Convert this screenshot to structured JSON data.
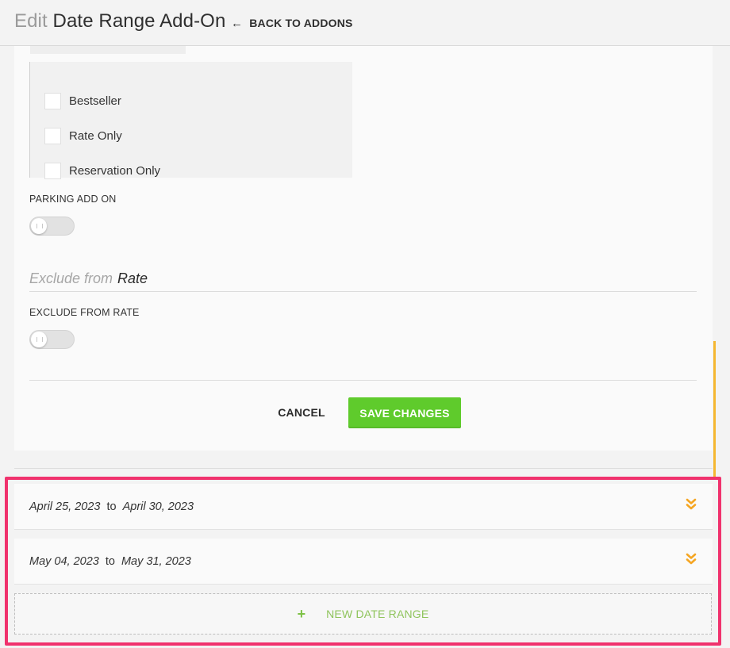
{
  "header": {
    "edit_word": "Edit",
    "title": "Date Range Add-On",
    "back_label": "BACK TO ADDONS"
  },
  "options": [
    {
      "label": "Bestseller",
      "checked": false
    },
    {
      "label": "Rate Only",
      "checked": false
    },
    {
      "label": "Reservation Only",
      "checked": false
    }
  ],
  "parking": {
    "label": "PARKING ADD ON",
    "enabled": false
  },
  "exclude_section": {
    "muted": "Exclude from",
    "strong": "Rate"
  },
  "exclude_rate": {
    "label": "EXCLUDE FROM RATE",
    "enabled": false
  },
  "actions": {
    "cancel": "CANCEL",
    "save": "SAVE CHANGES"
  },
  "date_ranges": [
    {
      "start": "April 25, 2023",
      "to": "to",
      "end": "April 30, 2023"
    },
    {
      "start": "May 04, 2023",
      "to": "to",
      "end": "May 31, 2023"
    }
  ],
  "new_range": {
    "icon": "+",
    "label": "NEW DATE RANGE"
  },
  "colors": {
    "accent_green": "#5fcb2c",
    "highlight": "#f0326d",
    "expand_orange": "#f5a623",
    "scroll_orange": "#f5b731"
  }
}
